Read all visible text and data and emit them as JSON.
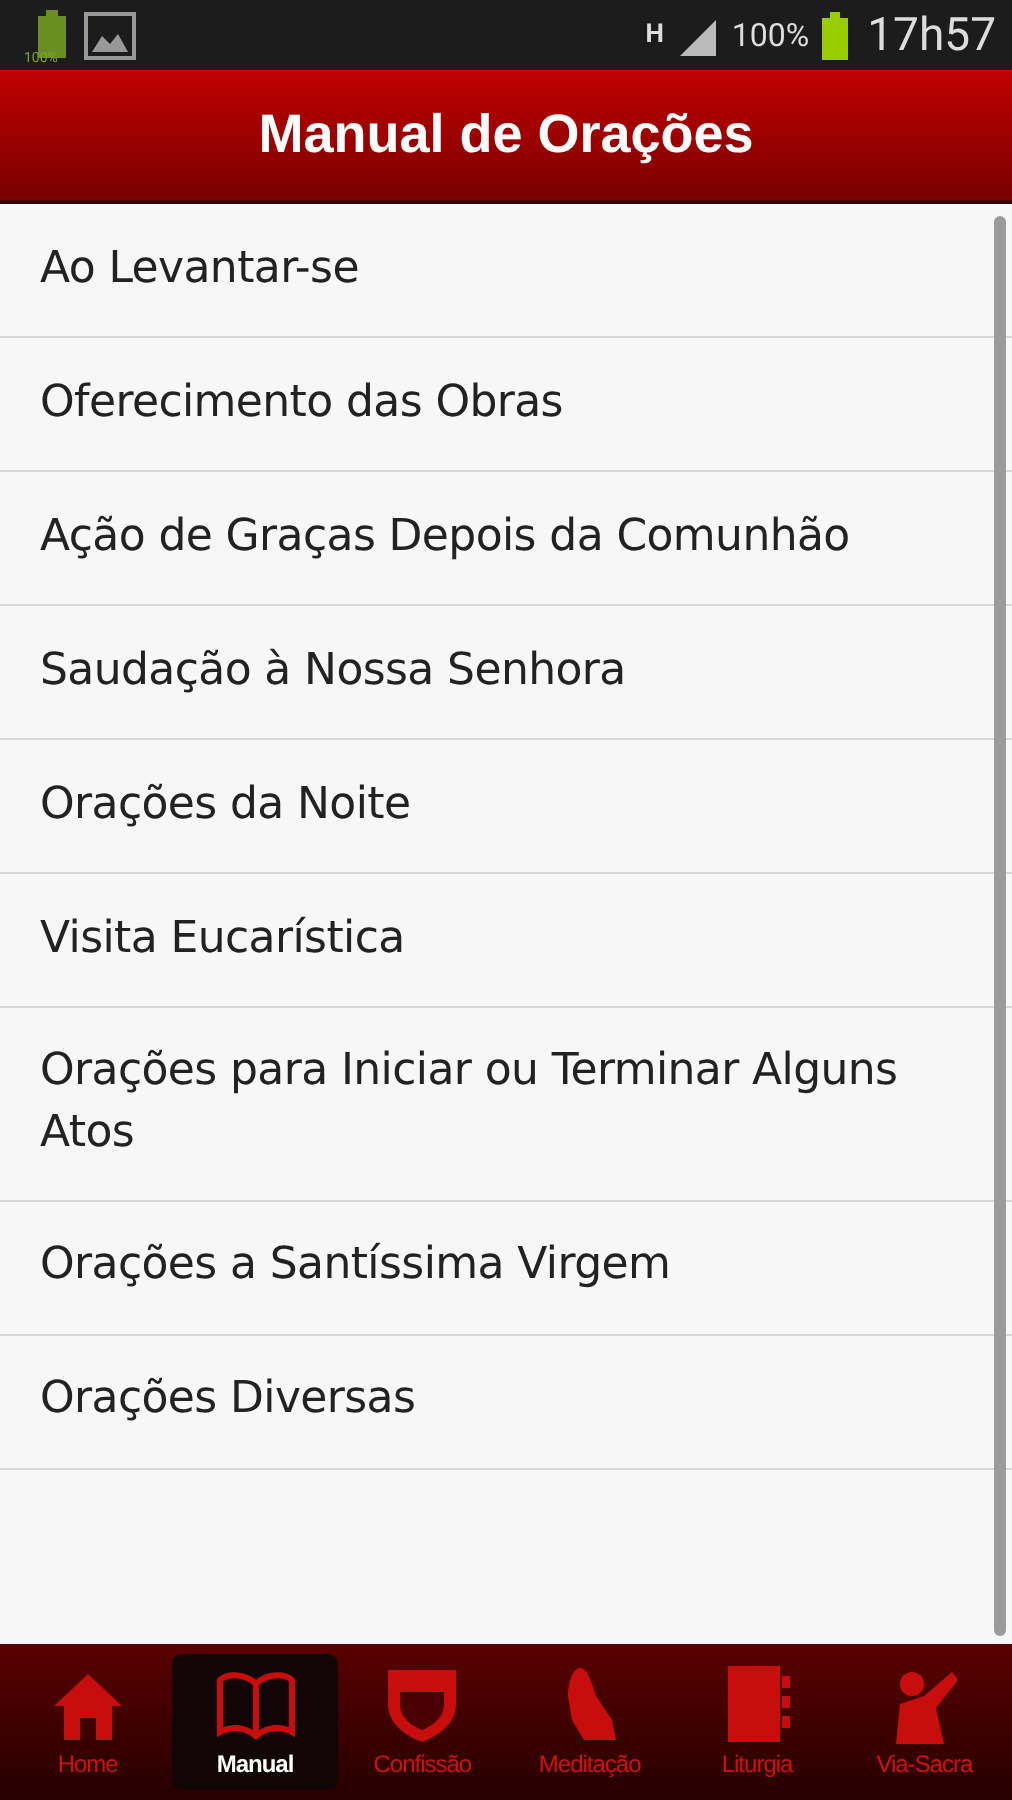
{
  "status_bar": {
    "storage_label": "100%",
    "network": "H",
    "battery": "100%",
    "time": "17h57"
  },
  "header": {
    "title": "Manual de Orações"
  },
  "list": {
    "items": [
      {
        "label": "Ao Levantar-se"
      },
      {
        "label": "Oferecimento das Obras"
      },
      {
        "label": "Ação de Graças Depois da Comunhão"
      },
      {
        "label": "Saudação à Nossa Senhora"
      },
      {
        "label": "Orações da Noite"
      },
      {
        "label": "Visita Eucarística"
      },
      {
        "label": "Orações para Iniciar ou Terminar Alguns Atos"
      },
      {
        "label": "Orações a Santíssima Virgem"
      },
      {
        "label": "Orações Diversas"
      }
    ]
  },
  "tabs": [
    {
      "label": "Home",
      "kind": "home",
      "selected": false
    },
    {
      "label": "Manual",
      "kind": "book",
      "selected": true
    },
    {
      "label": "Confissão",
      "kind": "shield",
      "selected": false
    },
    {
      "label": "Meditação",
      "kind": "hands",
      "selected": false
    },
    {
      "label": "Liturgia",
      "kind": "notebook",
      "selected": false
    },
    {
      "label": "Via-Sacra",
      "kind": "figure",
      "selected": false
    }
  ]
}
